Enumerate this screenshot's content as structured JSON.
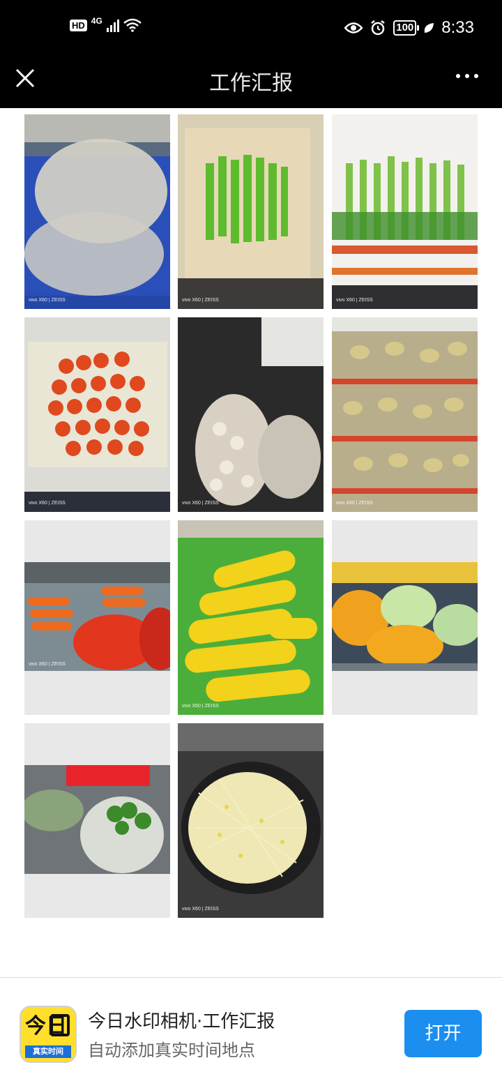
{
  "status_bar": {
    "hd": "HD",
    "network": "4G",
    "battery": "100",
    "time": "8:33",
    "icons": [
      "hd-icon",
      "signal-icon",
      "wifi-icon",
      "eye-icon",
      "alarm-icon",
      "battery-icon",
      "leaf-icon"
    ]
  },
  "nav": {
    "title": "工作汇报",
    "close_icon": "close-icon",
    "more_icon": "more-icon"
  },
  "photos": [
    {
      "subject": "plastic bags in blue crate",
      "watermark": "vivo X60 | ZEISS"
    },
    {
      "subject": "green peppers in crate",
      "watermark": "vivo X60 | ZEISS"
    },
    {
      "subject": "celery in foam box",
      "watermark": "vivo X60 | ZEISS"
    },
    {
      "subject": "tomatoes in crate",
      "watermark": "vivo X60 | ZEISS"
    },
    {
      "subject": "mushrooms in bags",
      "watermark": "vivo X60 | ZEISS"
    },
    {
      "subject": "potatoes in mesh bags",
      "watermark": "vivo X60 | ZEISS"
    },
    {
      "subject": "carrots in bags",
      "watermark": "vivo X60 | ZEISS"
    },
    {
      "subject": "corn cobs",
      "watermark": "vivo X60 | ZEISS"
    },
    {
      "subject": "vegetable sacks",
      "watermark": ""
    },
    {
      "subject": "leafy greens in bag",
      "watermark": ""
    },
    {
      "subject": "bean sprouts",
      "watermark": "vivo X60 | ZEISS"
    }
  ],
  "footer": {
    "app_icon_text": "今日",
    "app_icon_tag": "真实时间",
    "app_name": "今日水印相机·工作汇报",
    "app_desc": "自动添加真实时间地点",
    "open_button": "打开"
  },
  "colors": {
    "open_button": "#1b8ef0",
    "app_icon_bg": "#ffdf2b"
  }
}
